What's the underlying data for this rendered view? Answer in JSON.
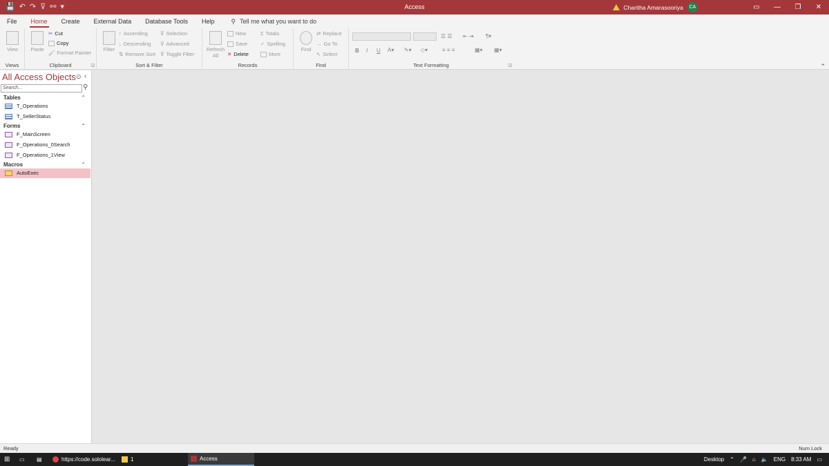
{
  "window": {
    "title": "Access",
    "user_name": "Charitha Amarasooriya",
    "user_initials": "CA",
    "controls": [
      "—",
      "❐",
      "✕"
    ],
    "maximize_glyph": "▭"
  },
  "quick_access": [
    "💾",
    "↶",
    "↷",
    "⊽",
    "⚯",
    "▾"
  ],
  "tabs": [
    "File",
    "Home",
    "Create",
    "External Data",
    "Database Tools",
    "Help"
  ],
  "tell_me": "Tell me what you want to do",
  "ribbon": {
    "views": {
      "label": "Views",
      "view": "View"
    },
    "clipboard": {
      "label": "Clipboard",
      "paste": "Paste",
      "cut": "Cut",
      "copy": "Copy",
      "format_painter": "Format Painter"
    },
    "sort_filter": {
      "label": "Sort & Filter",
      "filter": "Filter",
      "ascending": "Ascending",
      "descending": "Descending",
      "remove_sort": "Remove Sort",
      "selection": "Selection",
      "advanced": "Advanced",
      "toggle_filter": "Toggle Filter"
    },
    "records": {
      "label": "Records",
      "refresh": "Refresh All",
      "new": "New",
      "save": "Save",
      "delete": "Delete",
      "totals": "Totals",
      "spelling": "Spelling",
      "more": "More"
    },
    "find": {
      "label": "Find",
      "find": "Find",
      "replace": "Replace",
      "goto": "Go To",
      "select": "Select"
    },
    "text_formatting": {
      "label": "Text Formatting",
      "bold": "B",
      "italic": "I",
      "underline": "U"
    }
  },
  "nav": {
    "title": "All Access Objects",
    "search_placeholder": "Search...",
    "sections": [
      {
        "name": "Tables",
        "items": [
          "T_Operations",
          "T_SellerStatus"
        ]
      },
      {
        "name": "Forms",
        "items": [
          "F_MainScreen",
          "F_Operations_0Search",
          "F_Operations_1View"
        ]
      },
      {
        "name": "Macros",
        "items": [
          "AutoExec"
        ]
      }
    ]
  },
  "status": {
    "left": "Ready",
    "right": "Num Lock"
  },
  "taskbar": {
    "browser": "https://code.sololear...",
    "folder": "1",
    "access": "Access",
    "desktop": "Desktop",
    "lang": "ENG",
    "time": "8:33 AM"
  }
}
